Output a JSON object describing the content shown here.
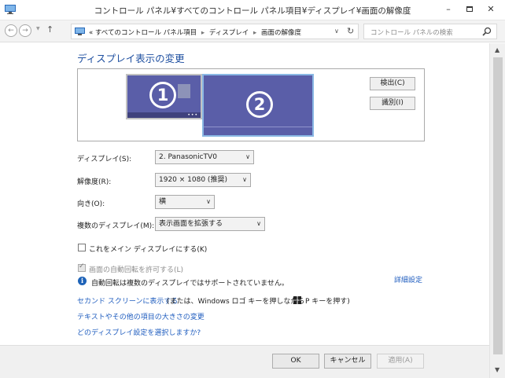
{
  "window": {
    "title": "コントロール パネル¥すべてのコントロール パネル項目¥ディスプレイ¥画面の解像度",
    "minimize": "–",
    "close": "✕"
  },
  "nav": {
    "back": "←",
    "forward": "→",
    "up": "↑",
    "breadcrumb_prefix": "«",
    "breadcrumbs": [
      "すべてのコントロール パネル項目",
      "ディスプレイ",
      "画面の解像度"
    ],
    "separator": "▸",
    "dropdown": "∨",
    "refresh": "↻",
    "search_placeholder": "コントロール パネルの検索"
  },
  "page": {
    "title": "ディスプレイ表示の変更",
    "monitors": [
      "1",
      "2"
    ],
    "detect_button": "検出(C)",
    "identify_button": "識別(I)"
  },
  "settings": {
    "display_label": "ディスプレイ(S):",
    "display_value": "2. PanasonicTV0",
    "resolution_label": "解像度(R):",
    "resolution_value": "1920 × 1080 (推奨)",
    "orientation_label": "向き(O):",
    "orientation_value": "横",
    "multi_label": "複数のディスプレイ(M):",
    "multi_value": "表示画面を拡張する",
    "make_main_label": "これをメイン ディスプレイにする(K)",
    "make_main_checked": false,
    "auto_rotate_label": "画面の自動回転を許可する(L)",
    "auto_rotate_checked": true,
    "info_text": "自動回転は複数のディスプレイではサポートされていません。",
    "advanced_link": "詳細設定"
  },
  "links": {
    "second_screen": "セカンド スクリーンに表示する",
    "second_screen_hint_pre": "(または、Windows ロゴ キーを押しながら",
    "second_screen_hint_post": "P キーを押す)",
    "text_size": "テキストやその他の項目の大きさの変更",
    "which_setting": "どのディスプレイ設定を選択しますか?"
  },
  "footer": {
    "ok": "OK",
    "cancel": "キャンセル",
    "apply": "適用(A)"
  },
  "colors": {
    "accent_link": "#1f5dbf",
    "title_blue": "#1e4fa0",
    "monitor_fill": "#5a5ea8",
    "selected_border": "#8ab8e4"
  },
  "icons": [
    "control-panel-icon",
    "monitor-icon",
    "search-icon",
    "info-icon",
    "windows-logo-icon"
  ]
}
